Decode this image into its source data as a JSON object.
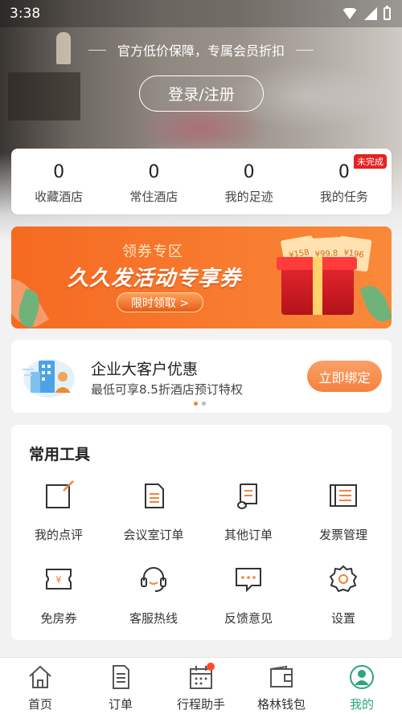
{
  "status_bar": {
    "time": "3:38"
  },
  "hero": {
    "promo_text": "官方低价保障，专属会员折扣",
    "login_label": "登录/注册"
  },
  "stats": [
    {
      "value": "0",
      "label": "收藏酒店"
    },
    {
      "value": "0",
      "label": "常住酒店"
    },
    {
      "value": "0",
      "label": "我的足迹"
    },
    {
      "value": "0",
      "label": "我的任务",
      "badge": "未完成"
    }
  ],
  "banner": {
    "small_title": "领券专区",
    "big_title": "久久发活动专享券",
    "button_label": "限时领取 >",
    "coupons": [
      "¥158",
      "¥99.8",
      "¥196"
    ]
  },
  "enterprise": {
    "title": "企业大客户优惠",
    "subtitle": "最低可享8.5折酒店预订特权",
    "button_label": "立即绑定"
  },
  "tools": {
    "title": "常用工具",
    "items": [
      {
        "label": "我的点评",
        "icon": "review-icon"
      },
      {
        "label": "会议室订单",
        "icon": "meeting-order-icon"
      },
      {
        "label": "其他订单",
        "icon": "scroll-icon"
      },
      {
        "label": "发票管理",
        "icon": "invoice-icon"
      },
      {
        "label": "免房券",
        "icon": "ticket-icon"
      },
      {
        "label": "客服热线",
        "icon": "headset-icon"
      },
      {
        "label": "反馈意见",
        "icon": "feedback-icon"
      },
      {
        "label": "设置",
        "icon": "gear-icon"
      }
    ]
  },
  "bottom_nav": [
    {
      "label": "首页",
      "icon": "home-icon"
    },
    {
      "label": "订单",
      "icon": "order-icon"
    },
    {
      "label": "行程助手",
      "icon": "calendar-icon"
    },
    {
      "label": "格林钱包",
      "icon": "wallet-icon"
    },
    {
      "label": "我的",
      "icon": "profile-icon",
      "active": true
    }
  ],
  "colors": {
    "accent": "#f4823f",
    "active_nav": "#2aa67a",
    "badge": "#e52222"
  }
}
